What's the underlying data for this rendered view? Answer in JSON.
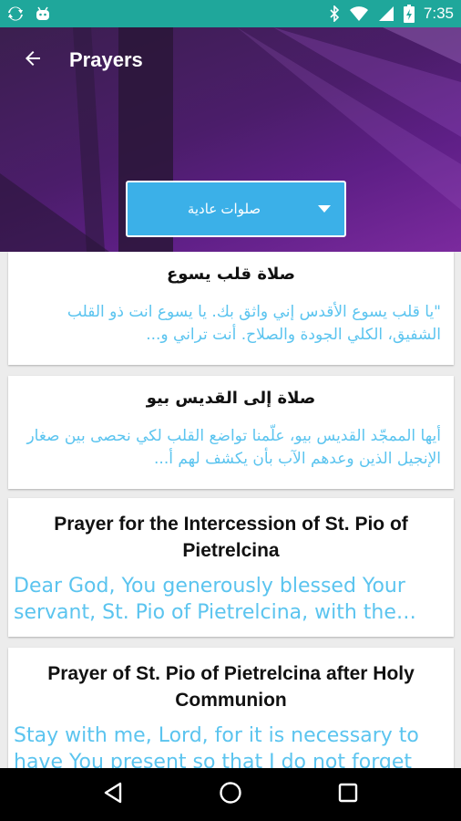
{
  "status_bar": {
    "time": "7:35",
    "left_icons": [
      "sync-icon",
      "android-icon"
    ],
    "right_icons": [
      "bluetooth-icon",
      "wifi-icon",
      "signal-icon",
      "battery-icon"
    ]
  },
  "toolbar": {
    "title": "Prayers",
    "back_icon": "arrow-left-icon"
  },
  "category_select": {
    "value": "صلوات عادية"
  },
  "prayers": [
    {
      "title": "صلاة قلب يسوع",
      "excerpt": "\"يا قلب يسوع الأقدس إني واثق بك. يا يسوع انت ذو القلب الشفيق، الكلي الجودة والصلاح. أنت تراني و..."
    },
    {
      "title": "صلاة إلى القديس بيو",
      "excerpt": "أيها الممجّد القديس بيو، علّمنا تواضع القلب لكي نحصى بين صغار الإنجيل الذين وعدهم الآب بأن يكشف لهم أ..."
    },
    {
      "title": "Prayer for the Intercession of St. Pio of Pietrelcina",
      "excerpt": "Dear God, You generously blessed Your servant, St. Pio of Pietrelcina, with the gift..."
    },
    {
      "title": "Prayer of St. Pio of Pietrelcina after Holy Communion",
      "excerpt": "Stay with me, Lord, for it is necessary to have You present so that I do not forget Y..."
    }
  ],
  "nav_bar": {
    "buttons": [
      "back-triangle-icon",
      "home-circle-icon",
      "recents-square-icon"
    ]
  },
  "colors": {
    "status_bar": "#1fa79b",
    "dropdown": "#3bb0e8",
    "excerpt_text": "#5bc4ef",
    "header_purple": "#5e1f86"
  }
}
